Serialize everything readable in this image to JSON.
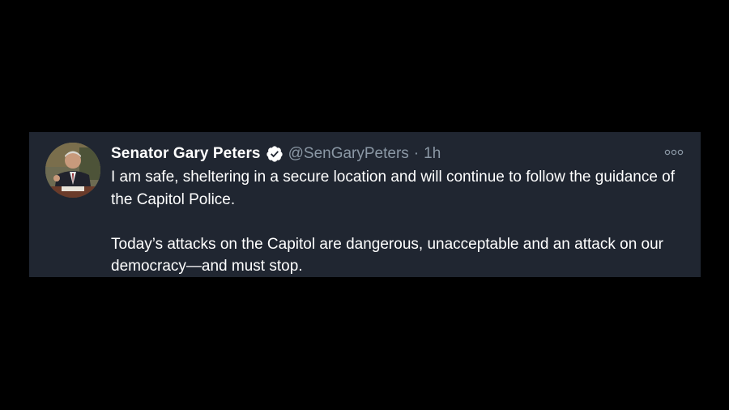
{
  "tweet": {
    "display_name": "Senator Gary Peters",
    "handle": "@SenGaryPeters",
    "separator": "·",
    "time": "1h",
    "verified": true,
    "paragraphs": [
      "I am safe, sheltering in a secure location and will continue to follow the guidance of the Capitol Police.",
      "Today’s attacks on the Capitol are dangerous, unacceptable and an attack on our democracy—and must stop."
    ],
    "icons": {
      "avatar": "avatar",
      "verified": "verified-badge-icon",
      "more": "more-options-icon"
    }
  },
  "colors": {
    "page_background": "#000000",
    "card_background": "#202631",
    "primary_text": "#ffffff",
    "secondary_text": "#8b98a5"
  }
}
